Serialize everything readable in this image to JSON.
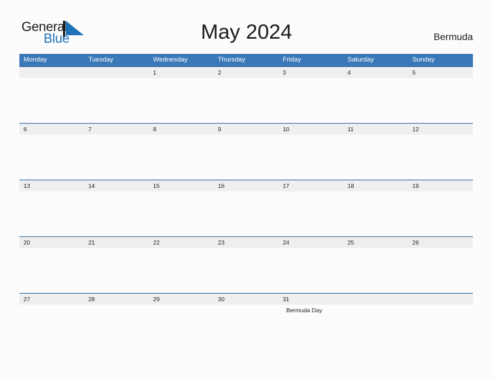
{
  "brand": {
    "word_one": "General",
    "word_two": "Blue",
    "mark_icon": "sail-triangle-icon",
    "accent_color": "#1f72b8"
  },
  "header": {
    "title": "May 2024",
    "country": "Bermuda"
  },
  "colors": {
    "weekday_header_bg": "#3a78b8",
    "weekday_header_text": "#ffffff",
    "date_band_bg": "#efefef",
    "date_band_rule": "#2e6da4",
    "page_bg": "#fcfcfc"
  },
  "calendar": {
    "weekdays": [
      "Monday",
      "Tuesday",
      "Wednesday",
      "Thursday",
      "Friday",
      "Saturday",
      "Sunday"
    ],
    "weeks": [
      {
        "days": [
          {
            "date": "",
            "note": ""
          },
          {
            "date": "",
            "note": ""
          },
          {
            "date": "1",
            "note": ""
          },
          {
            "date": "2",
            "note": ""
          },
          {
            "date": "3",
            "note": ""
          },
          {
            "date": "4",
            "note": ""
          },
          {
            "date": "5",
            "note": ""
          }
        ]
      },
      {
        "days": [
          {
            "date": "6",
            "note": ""
          },
          {
            "date": "7",
            "note": ""
          },
          {
            "date": "8",
            "note": ""
          },
          {
            "date": "9",
            "note": ""
          },
          {
            "date": "10",
            "note": ""
          },
          {
            "date": "11",
            "note": ""
          },
          {
            "date": "12",
            "note": ""
          }
        ]
      },
      {
        "days": [
          {
            "date": "13",
            "note": ""
          },
          {
            "date": "14",
            "note": ""
          },
          {
            "date": "15",
            "note": ""
          },
          {
            "date": "16",
            "note": ""
          },
          {
            "date": "17",
            "note": ""
          },
          {
            "date": "18",
            "note": ""
          },
          {
            "date": "19",
            "note": ""
          }
        ]
      },
      {
        "days": [
          {
            "date": "20",
            "note": ""
          },
          {
            "date": "21",
            "note": ""
          },
          {
            "date": "22",
            "note": ""
          },
          {
            "date": "23",
            "note": ""
          },
          {
            "date": "24",
            "note": ""
          },
          {
            "date": "25",
            "note": ""
          },
          {
            "date": "26",
            "note": ""
          }
        ]
      },
      {
        "days": [
          {
            "date": "27",
            "note": ""
          },
          {
            "date": "28",
            "note": ""
          },
          {
            "date": "29",
            "note": ""
          },
          {
            "date": "30",
            "note": ""
          },
          {
            "date": "31",
            "note": "Bermuda Day"
          },
          {
            "date": "",
            "note": ""
          },
          {
            "date": "",
            "note": ""
          }
        ]
      }
    ]
  }
}
